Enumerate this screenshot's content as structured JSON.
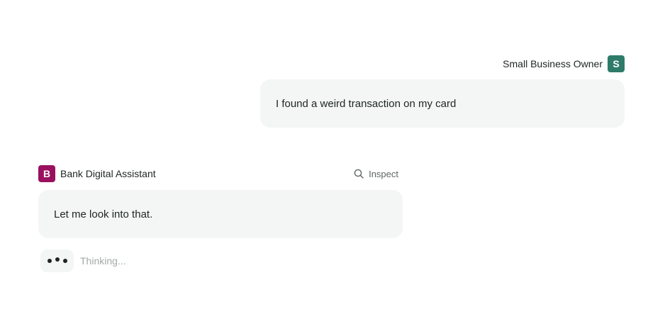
{
  "user": {
    "name": "Small Business Owner",
    "avatar_letter": "S",
    "avatar_color": "#2f7b6a",
    "message": "I found a weird transaction on my card"
  },
  "assistant": {
    "name": "Bank Digital Assistant",
    "avatar_letter": "B",
    "avatar_color": "#99115e",
    "inspect_label": "Inspect",
    "inspect_icon": "search-icon",
    "message": "Let me look into that.",
    "thinking_label": "Thinking..."
  },
  "colors": {
    "bubble_background": "#f3f6f5",
    "muted_text": "#a3a9a7"
  }
}
